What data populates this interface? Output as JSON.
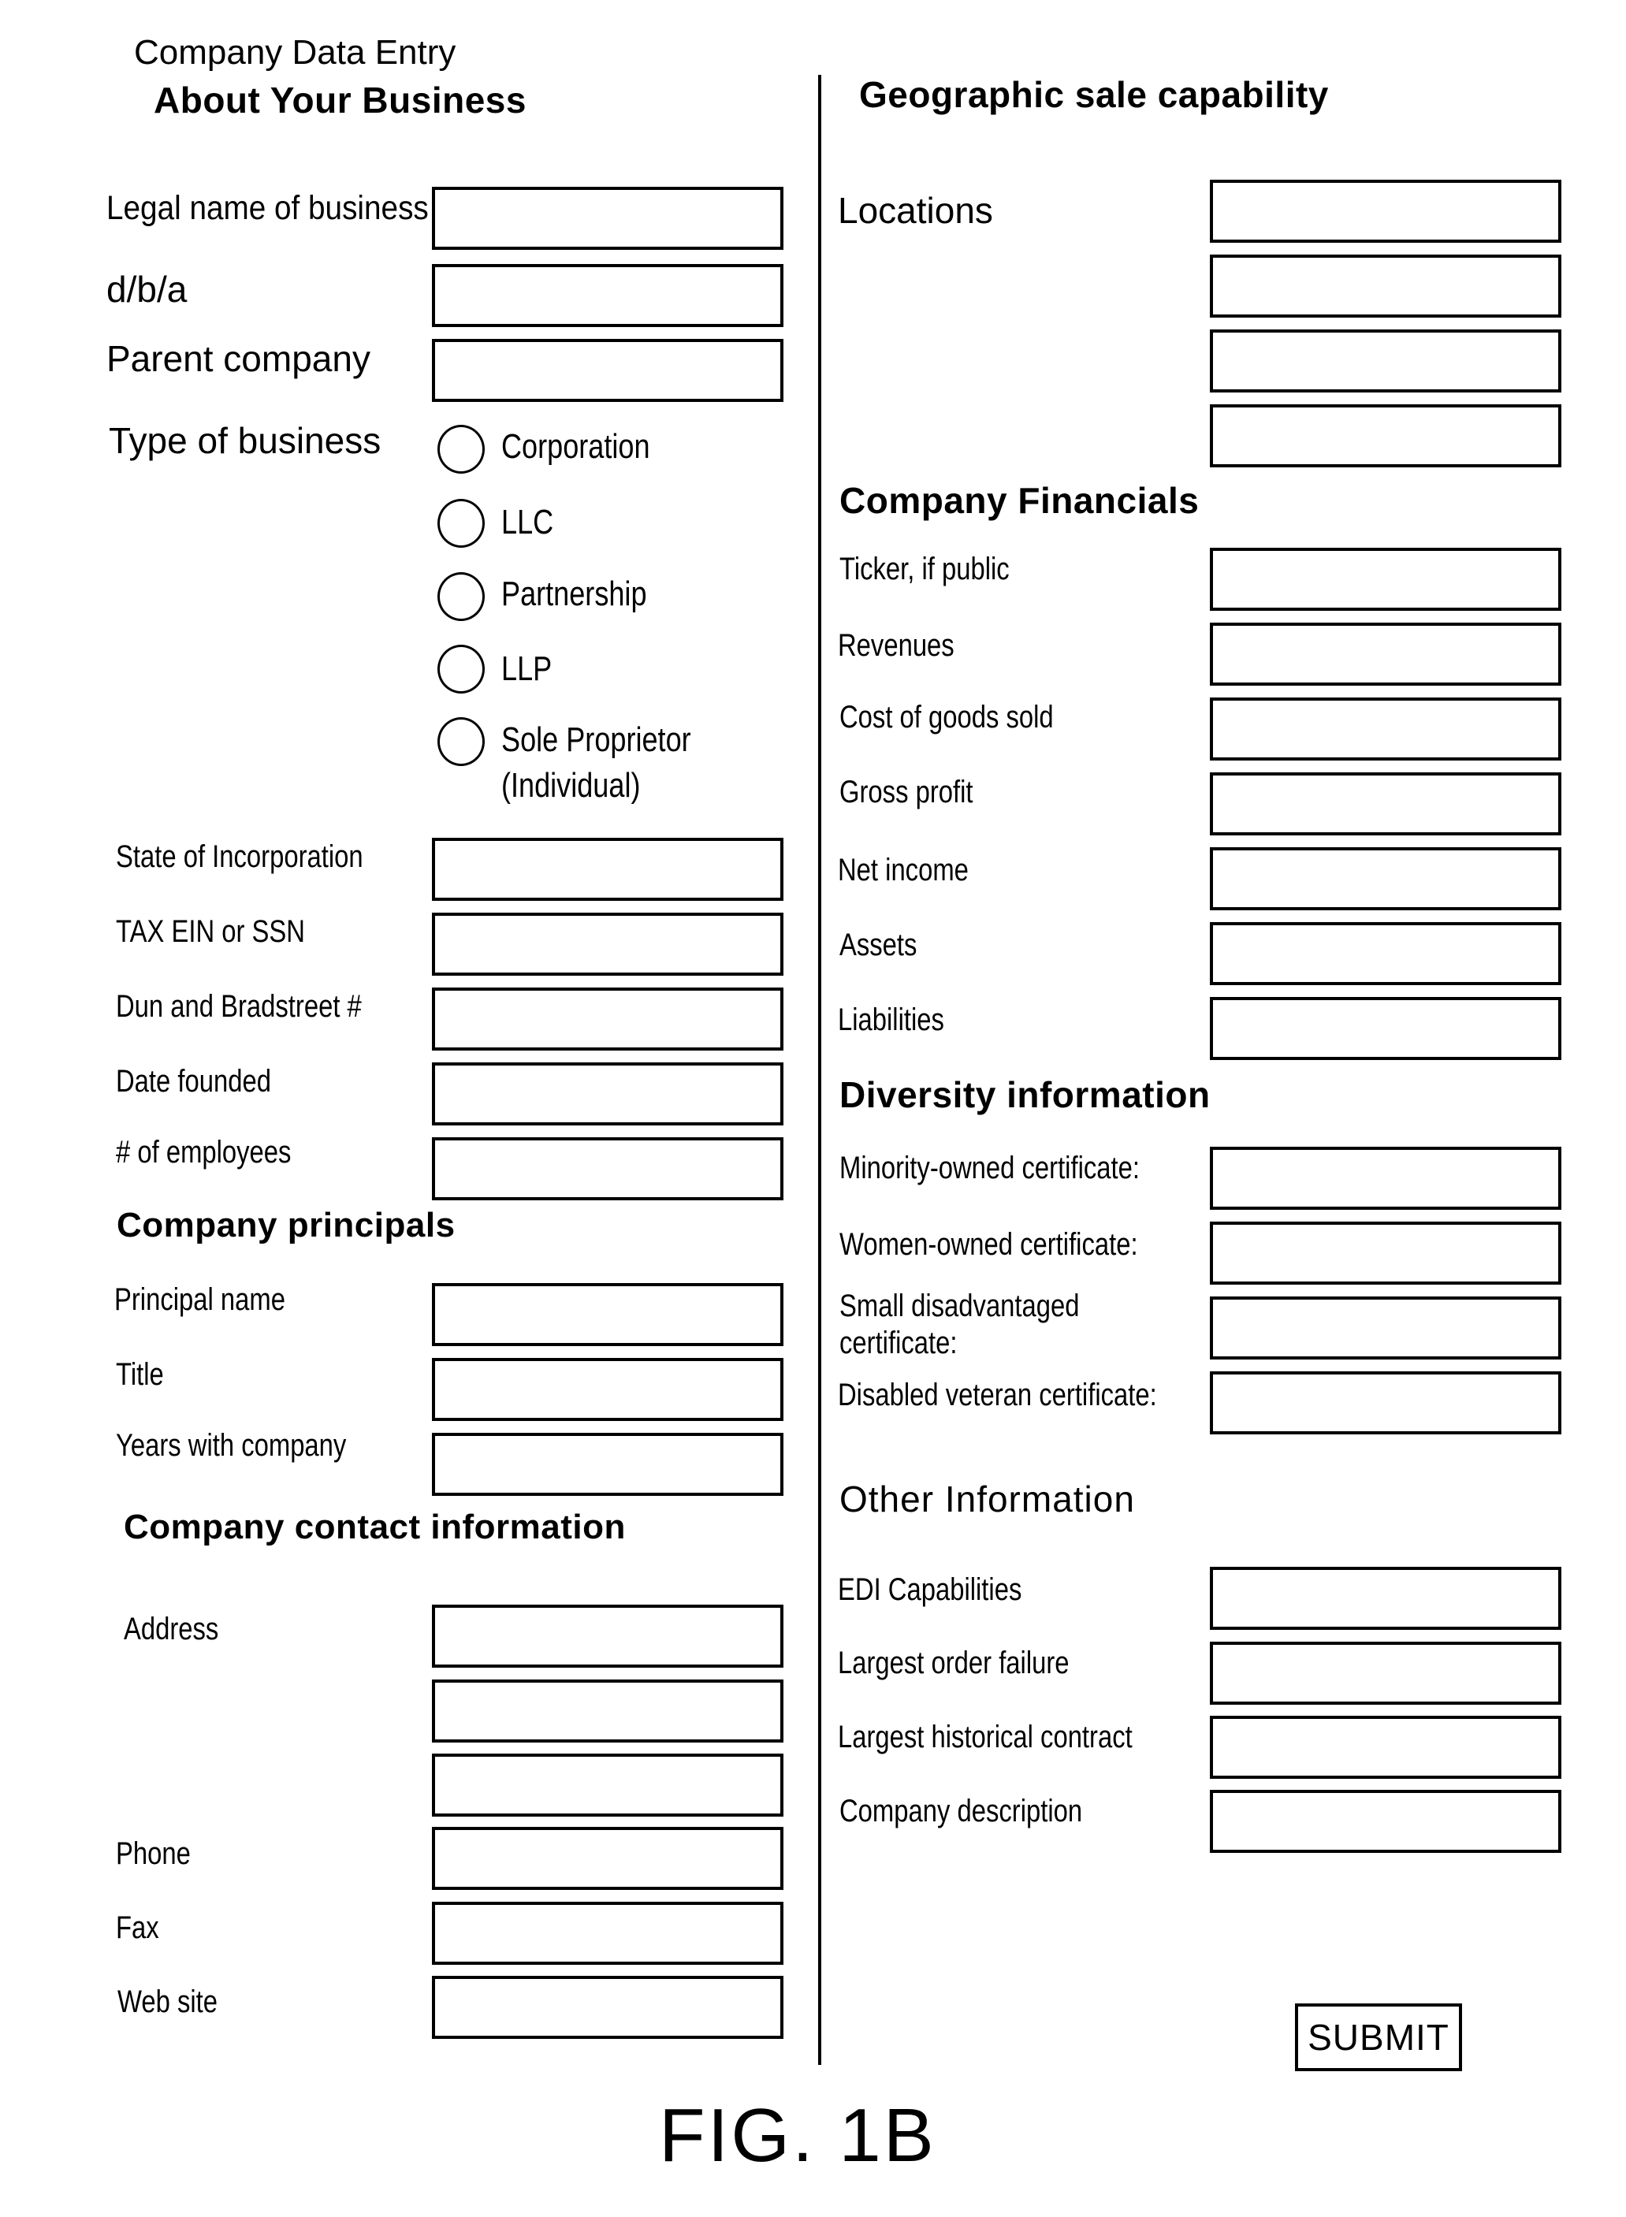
{
  "form": {
    "title": "Company Data Entry",
    "submit_label": "SUBMIT"
  },
  "figure_label": "FIG. 1B",
  "about": {
    "heading": "About Your Business",
    "legal_name": {
      "label": "Legal name of business",
      "value": ""
    },
    "dba": {
      "label": "d/b/a",
      "value": ""
    },
    "parent_company": {
      "label": "Parent company",
      "value": ""
    },
    "type_of_business": {
      "label": "Type of business",
      "options": [
        {
          "label": "Corporation",
          "selected": false
        },
        {
          "label": "LLC",
          "selected": false
        },
        {
          "label": "Partnership",
          "selected": false
        },
        {
          "label": "LLP",
          "selected": false
        },
        {
          "label": "Sole Proprietor",
          "sublabel": "(Individual)",
          "selected": false
        }
      ]
    },
    "fields": [
      {
        "label": "State of Incorporation",
        "value": ""
      },
      {
        "label": "TAX EIN or SSN",
        "value": ""
      },
      {
        "label": "Dun and Bradstreet #",
        "value": ""
      },
      {
        "label": "Date founded",
        "value": ""
      },
      {
        "label": "# of employees",
        "value": ""
      }
    ]
  },
  "principals": {
    "heading": "Company principals",
    "fields": [
      {
        "label": "Principal name",
        "value": ""
      },
      {
        "label": "Title",
        "value": ""
      },
      {
        "label": "Years with company",
        "value": ""
      }
    ]
  },
  "contact": {
    "heading": "Company contact information",
    "address": {
      "label": "Address",
      "lines": [
        "",
        "",
        ""
      ]
    },
    "fields": [
      {
        "label": "Phone",
        "value": ""
      },
      {
        "label": "Fax",
        "value": ""
      },
      {
        "label": "Web site",
        "value": ""
      }
    ]
  },
  "geographic": {
    "heading": "Geographic sale capability",
    "locations": {
      "label": "Locations",
      "values": [
        "",
        "",
        "",
        ""
      ]
    }
  },
  "financials": {
    "heading": "Company Financials",
    "fields": [
      {
        "label": "Ticker, if public",
        "value": ""
      },
      {
        "label": "Revenues",
        "value": ""
      },
      {
        "label": "Cost of goods sold",
        "value": ""
      },
      {
        "label": "Gross profit",
        "value": ""
      },
      {
        "label": "Net income",
        "value": ""
      },
      {
        "label": "Assets",
        "value": ""
      },
      {
        "label": "Liabilities",
        "value": ""
      }
    ]
  },
  "diversity": {
    "heading": "Diversity information",
    "fields": [
      {
        "label": "Minority-owned certificate:",
        "value": ""
      },
      {
        "label": "Women-owned certificate:",
        "value": ""
      },
      {
        "label": "Small disadvantaged",
        "label_line2": "certificate:",
        "value": ""
      },
      {
        "label": "Disabled veteran certificate:",
        "value": ""
      }
    ]
  },
  "other": {
    "heading": "Other Information",
    "fields": [
      {
        "label": "EDI Capabilities",
        "value": ""
      },
      {
        "label": "Largest order failure",
        "value": ""
      },
      {
        "label": "Largest historical contract",
        "value": ""
      },
      {
        "label": "Company description",
        "value": ""
      }
    ]
  }
}
